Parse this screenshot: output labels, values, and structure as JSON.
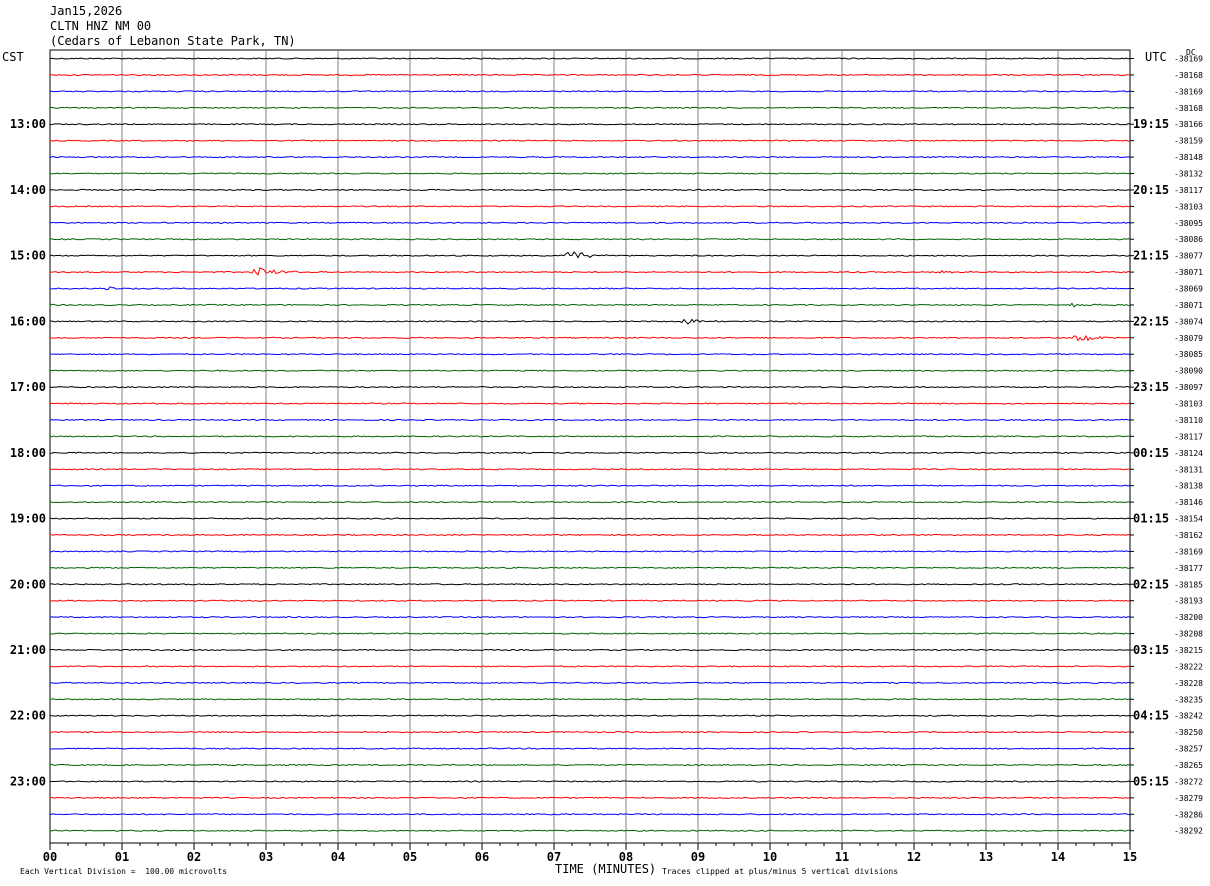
{
  "header": {
    "date": "Jan15,2026",
    "station": "CLTN HNZ NM 00",
    "location": "(Cedars of Lebanon State Park, TN)"
  },
  "labels": {
    "left_timezone": "CST",
    "right_timezone": "UTC",
    "dc_header": "DC"
  },
  "footer": {
    "scale": "Each Vertical Division =  100.00 microvolts",
    "xlabel": "TIME (MINUTES)",
    "clip_note": "Traces clipped at plus/minus 5 vertical divisions"
  },
  "colors": {
    "trace_cycle": [
      "#000000",
      "#ff0000",
      "#0000ff",
      "#006400"
    ],
    "grid": "#808080"
  },
  "chart_data": {
    "type": "line",
    "title": "CLTN HNZ NM 00",
    "xlabel": "TIME (MINUTES)",
    "xlim": [
      0,
      15
    ],
    "x_ticks": [
      "00",
      "01",
      "02",
      "03",
      "04",
      "05",
      "06",
      "07",
      "08",
      "09",
      "10",
      "11",
      "12",
      "13",
      "14",
      "15"
    ],
    "rows_per_hour": 4,
    "left_hour_labels": [
      "13:00",
      "14:00",
      "15:00",
      "16:00",
      "17:00",
      "18:00",
      "19:00",
      "20:00",
      "21:00",
      "22:00",
      "23:00"
    ],
    "right_hour_labels": [
      "19:15",
      "20:15",
      "21:15",
      "22:15",
      "23:15",
      "00:15",
      "01:15",
      "02:15",
      "03:15",
      "04:15",
      "05:15"
    ],
    "first_labeled_row": 4,
    "dc_offsets": [
      "-38169",
      "-38168",
      "-38169",
      "-38168",
      "-38166",
      "-38159",
      "-38148",
      "-38132",
      "-38117",
      "-38103",
      "-38095",
      "-38086",
      "-38077",
      "-38071",
      "-38069",
      "-38071",
      "-38074",
      "-38079",
      "-38085",
      "-38090",
      "-38097",
      "-38103",
      "-38110",
      "-38117",
      "-38124",
      "-38131",
      "-38138",
      "-38146",
      "-38154",
      "-38162",
      "-38169",
      "-38177",
      "-38185",
      "-38193",
      "-38200",
      "-38208",
      "-38215",
      "-38222",
      "-38228",
      "-38235",
      "-38242",
      "-38250",
      "-38257",
      "-38265",
      "-38272",
      "-38279",
      "-38286",
      "-38292"
    ],
    "events": [
      {
        "row": 12,
        "minute": 7.2,
        "amplitude": 0.9
      },
      {
        "row": 13,
        "minute": 2.85,
        "amplitude": 1.0
      },
      {
        "row": 13,
        "minute": 12.3,
        "amplitude": 0.25
      },
      {
        "row": 14,
        "minute": 0.8,
        "amplitude": 0.25
      },
      {
        "row": 15,
        "minute": 14.2,
        "amplitude": 0.25
      },
      {
        "row": 16,
        "minute": 8.8,
        "amplitude": 0.35
      },
      {
        "row": 17,
        "minute": 14.25,
        "amplitude": 0.75
      }
    ]
  }
}
